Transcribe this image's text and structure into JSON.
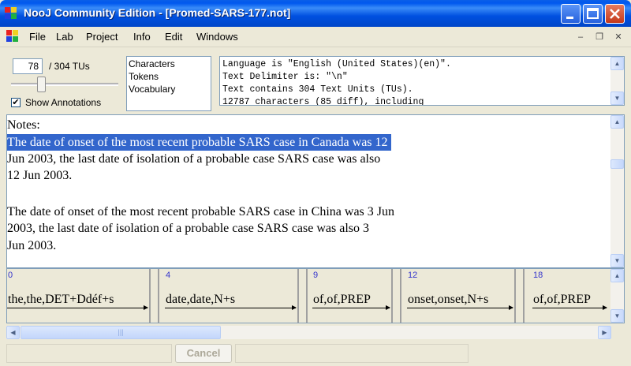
{
  "window": {
    "title": "NooJ Community Edition - [Promed-SARS-177.not]"
  },
  "menu": {
    "items": [
      "File",
      "Lab",
      "Project",
      "Info",
      "Edit",
      "Windows"
    ]
  },
  "tu": {
    "current": "78",
    "total_label": "/ 304 TUs",
    "slider_fraction": 0.26
  },
  "show_annotations": {
    "label": "Show Annotations",
    "checked": true
  },
  "list_items": [
    "Characters",
    "Tokens",
    "Vocabulary"
  ],
  "info_lines": [
    "Language is \"English (United States)(en)\".",
    "Text Delimiter is: \"\\n\"",
    "Text contains 304 Text Units (TUs).",
    "12787 characters (85 diff), including"
  ],
  "text_lines": [
    "Notes:",
    "The date of onset of the most recent probable SARS case in Canada was 12",
    "Jun 2003, the last date of isolation of a probable case SARS case was also",
    "12 Jun 2003.",
    "",
    "The date of onset of the most recent probable SARS case in China was 3 Jun",
    "2003, the last date of isolation of a probable case SARS case was also 3",
    "Jun 2003."
  ],
  "tokens": [
    {
      "num": "0",
      "ann": "the,the,DET+Ddéf+s"
    },
    {
      "num": "4",
      "ann": "date,date,N+s"
    },
    {
      "num": "9",
      "ann": "of,of,PREP"
    },
    {
      "num": "12",
      "ann": "onset,onset,N+s"
    },
    {
      "num": "18",
      "ann": "of,of,PREP"
    }
  ],
  "cancel_label": "Cancel",
  "colors": {
    "title_bar": "#0055E5",
    "selection": "#3366CC",
    "token_num": "#3333CC"
  },
  "icons": {
    "app": "nooj-logo-icon",
    "minimize": "minimize-icon",
    "maximize": "maximize-icon",
    "close": "close-icon",
    "scroll_up": "arrow-up-icon",
    "scroll_down": "arrow-down-icon",
    "scroll_left": "arrow-left-icon",
    "scroll_right": "arrow-right-icon"
  }
}
